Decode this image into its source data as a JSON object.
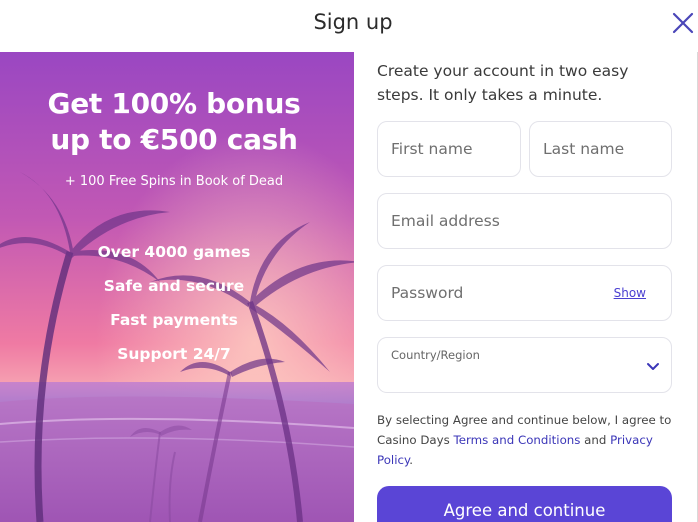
{
  "header": {
    "title": "Sign up",
    "close_icon": "close-icon"
  },
  "promo": {
    "headline_line1": "Get 100% bonus",
    "headline_line2": "up to €500 cash",
    "subline": "+ 100 Free Spins in Book of Dead",
    "features": [
      "Over 4000 games",
      "Safe and secure",
      "Fast payments",
      "Support 24/7"
    ],
    "background": "sunset-beach-palm-trees",
    "colors": {
      "sky_top": "#a44fc8",
      "sky_bottom": "#f27fa0"
    }
  },
  "form": {
    "intro": "Create your account in two easy steps. It only takes a minute.",
    "first_name_placeholder": "First name",
    "last_name_placeholder": "Last name",
    "email_placeholder": "Email address",
    "password_placeholder": "Password",
    "show_label": "Show",
    "country_label": "Country/Region",
    "country_value": "",
    "legal_prefix": "By selecting Agree and continue below, I agree to Casino Days ",
    "terms_link": "Terms and Conditions",
    "legal_and": " and ",
    "privacy_link": "Privacy Policy",
    "legal_suffix": ".",
    "cta_label": "Agree and continue",
    "accent_color": "#5a45d6"
  }
}
